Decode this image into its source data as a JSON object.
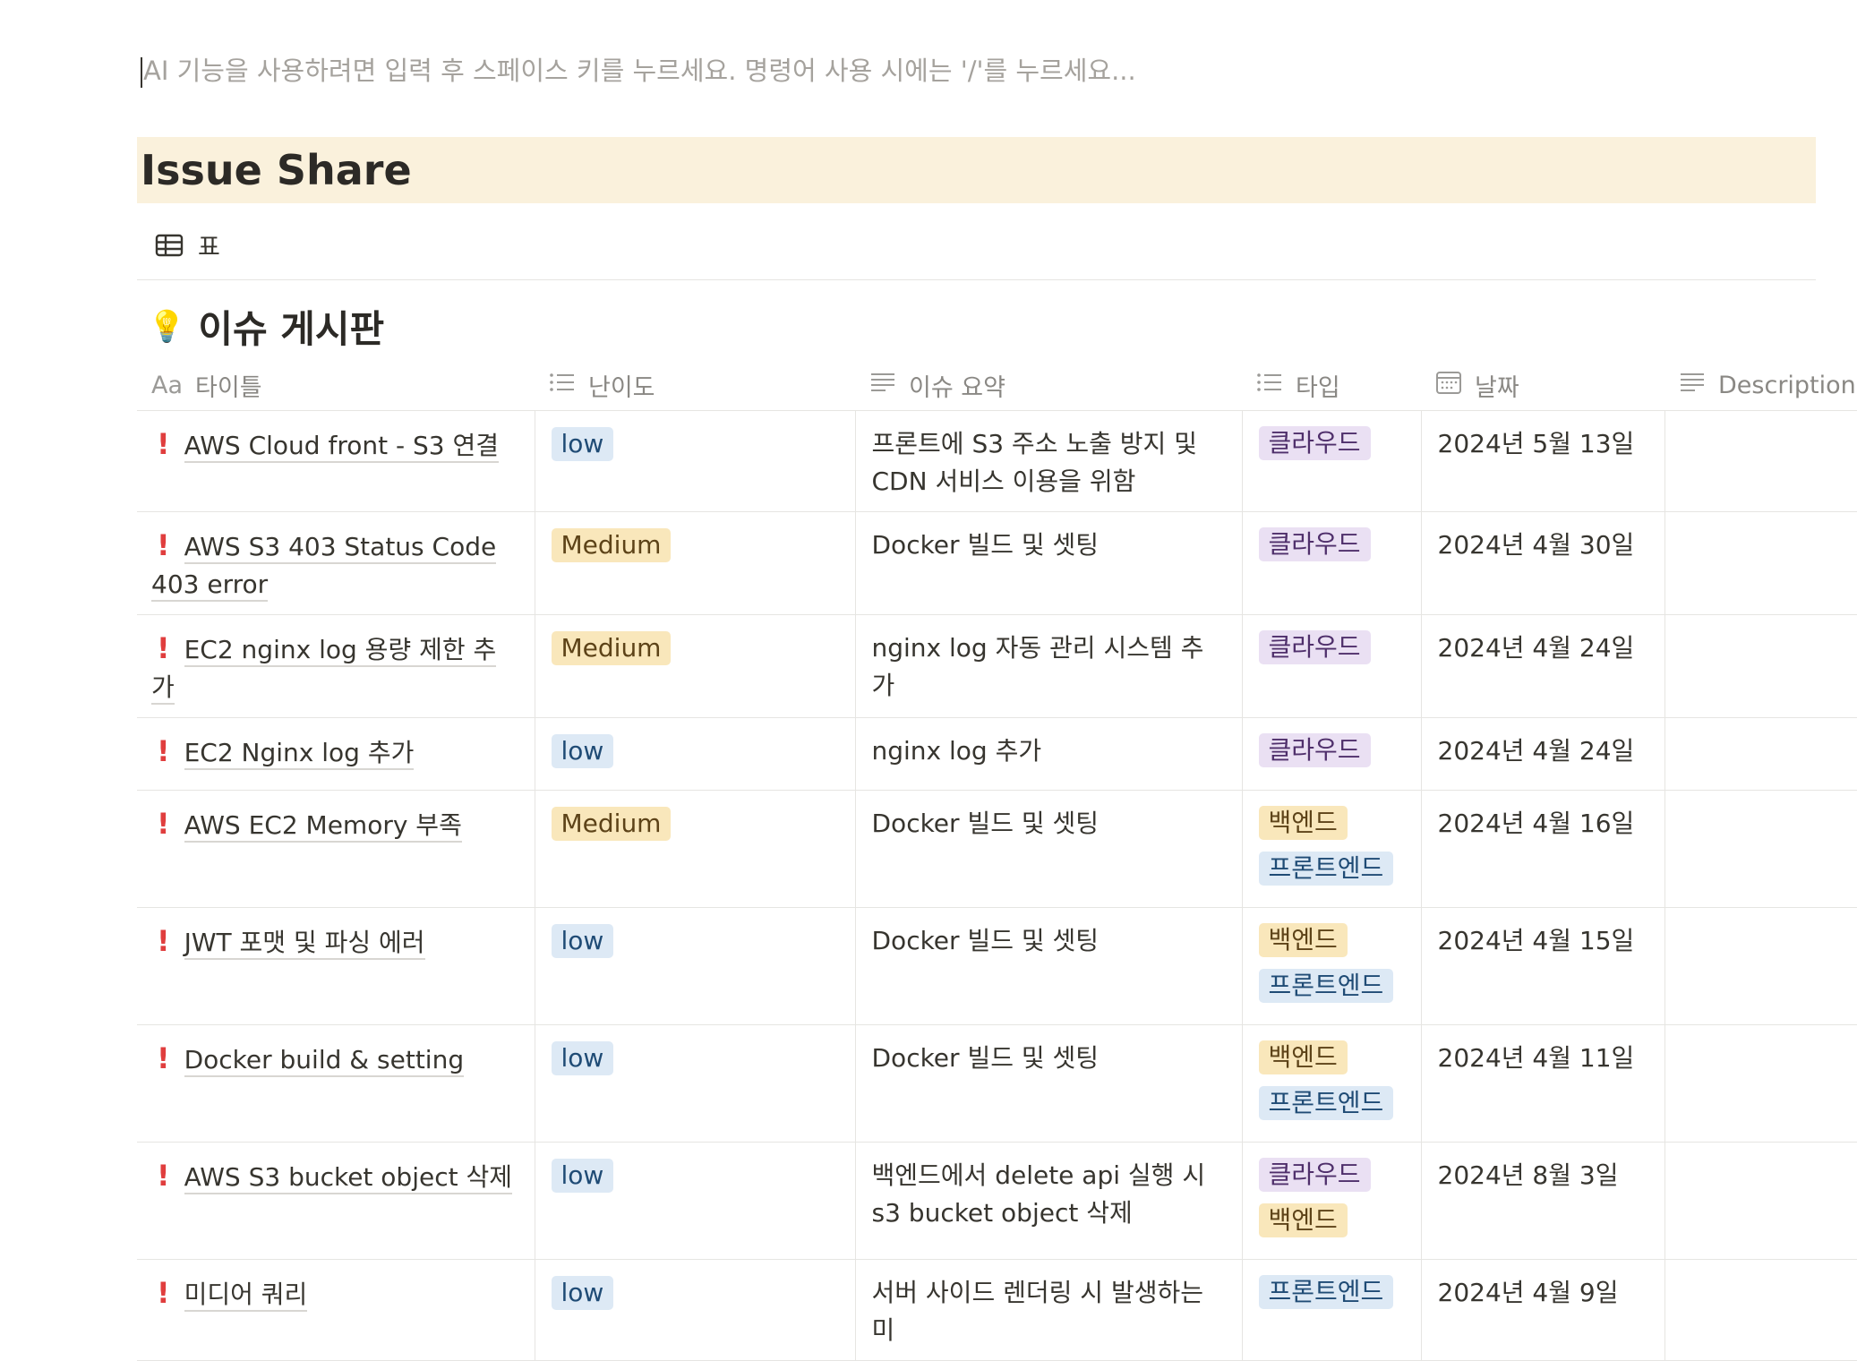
{
  "editor_hint": "AI 기능을 사용하려면 입력 후 스페이스 키를 누르세요. 명령어 사용 시에는 '/'를 누르세요...",
  "page_title": "Issue Share",
  "view_tab": {
    "icon": "table-icon",
    "label": "표"
  },
  "database": {
    "icon": "lightbulb-icon",
    "title": "이슈 게시판",
    "columns": [
      {
        "icon": "text-aa-icon",
        "icon_text": "Aa",
        "label": "타이틀"
      },
      {
        "icon": "list-icon",
        "label": "난이도"
      },
      {
        "icon": "text-lines-icon",
        "label": "이슈 요약"
      },
      {
        "icon": "list-icon",
        "label": "타입"
      },
      {
        "icon": "calendar-icon",
        "label": "날짜"
      },
      {
        "icon": "text-lines-icon",
        "label": "Description"
      }
    ],
    "rows": [
      {
        "icon": "exclamation-icon",
        "title": "AWS Cloud front - S3 연결",
        "difficulty": "low",
        "summary": "프론트에 S3 주소 노출 방지 및 CDN 서비스 이용을 위함",
        "types": [
          "클라우드"
        ],
        "date": "2024년 5월 13일",
        "description": ""
      },
      {
        "icon": "exclamation-icon",
        "title": "AWS S3 403 Status Code 403 error",
        "difficulty": "Medium",
        "summary": "Docker 빌드 및 셋팅",
        "types": [
          "클라우드"
        ],
        "date": "2024년 4월 30일",
        "description": ""
      },
      {
        "icon": "exclamation-icon",
        "title": "EC2 nginx log 용량 제한 추가",
        "difficulty": "Medium",
        "summary": "nginx log 자동 관리 시스템 추가",
        "types": [
          "클라우드"
        ],
        "date": "2024년 4월 24일",
        "description": ""
      },
      {
        "icon": "exclamation-icon",
        "title": "EC2 Nginx log 추가",
        "difficulty": "low",
        "summary": "nginx log 추가",
        "types": [
          "클라우드"
        ],
        "date": "2024년 4월 24일",
        "description": ""
      },
      {
        "icon": "exclamation-icon",
        "title": "AWS EC2 Memory 부족",
        "difficulty": "Medium",
        "summary": "Docker 빌드 및 셋팅",
        "types": [
          "백엔드",
          "프론트엔드"
        ],
        "date": "2024년 4월 16일",
        "description": ""
      },
      {
        "icon": "exclamation-icon",
        "title": "JWT 포맷 및 파싱 에러",
        "difficulty": "low",
        "summary": "Docker 빌드 및 셋팅",
        "types": [
          "백엔드",
          "프론트엔드"
        ],
        "date": "2024년 4월 15일",
        "description": ""
      },
      {
        "icon": "exclamation-icon",
        "title": "Docker build & setting",
        "difficulty": "low",
        "summary": "Docker 빌드 및 셋팅",
        "types": [
          "백엔드",
          "프론트엔드"
        ],
        "date": "2024년 4월 11일",
        "description": ""
      },
      {
        "icon": "exclamation-icon",
        "title": "AWS S3 bucket object 삭제",
        "difficulty": "low",
        "summary": "백엔드에서 delete api 실행 시 s3 bucket object 삭제",
        "types": [
          "클라우드",
          "백엔드"
        ],
        "date": "2024년 8월 3일",
        "description": ""
      },
      {
        "icon": "exclamation-icon",
        "title": "미디어 쿼리",
        "difficulty": "low",
        "summary": "서버 사이드 렌더링 시 발생하는 미",
        "types": [
          "프론트엔드"
        ],
        "date": "2024년 4월 9일",
        "description": ""
      }
    ]
  },
  "colors": {
    "low_tag": "#dde9f5",
    "medium_tag": "#f9e7bb",
    "cloud_tag": "#eae0f3",
    "backend_tag": "#f9e7bb",
    "frontend_tag": "#dde9f5",
    "banner_bg": "#faf1dc",
    "exclamation": "#e03e3e"
  }
}
